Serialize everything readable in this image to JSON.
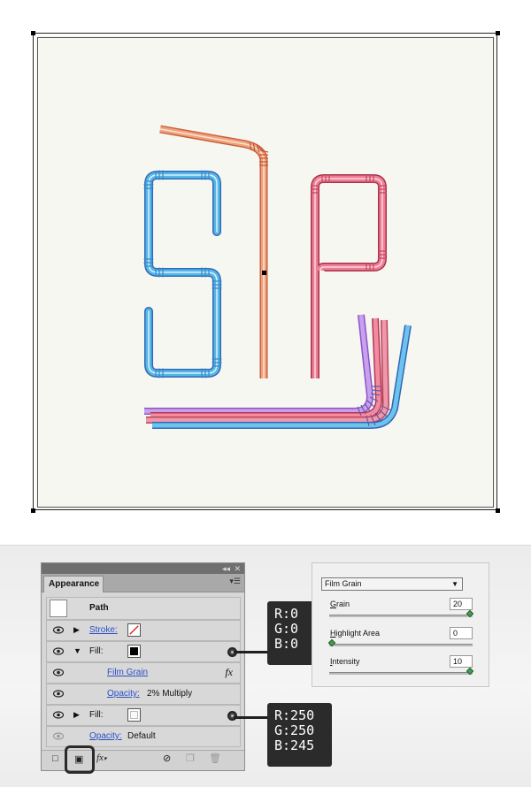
{
  "appearance_panel": {
    "tab_label": "Appearance",
    "rows": {
      "path_label": "Path",
      "stroke_label": "Stroke:",
      "fill1_label": "Fill:",
      "effect_label": "Film Grain",
      "opacity1_label": "Opacity:",
      "opacity1_value": "2% Multiply",
      "fill2_label": "Fill:",
      "opacity2_label": "Opacity:",
      "opacity2_value": "Default"
    },
    "fill1_color": "#000000",
    "fill2_color": "#FAFAF5"
  },
  "callouts": {
    "black": {
      "r": "R:0",
      "g": "G:0",
      "b": "B:0"
    },
    "cream": {
      "r": "R:250",
      "g": "G:250",
      "b": "B:245"
    }
  },
  "film_grain_dialog": {
    "selected_effect": "Film Grain",
    "grain_label_first": "G",
    "grain_label_rest": "rain",
    "grain_value": "20",
    "grain_fraction": 1.0,
    "highlight_label_first": "H",
    "highlight_label_rest": "ighlight Area",
    "highlight_value": "0",
    "highlight_fraction": 0.0,
    "intensity_label_first": "I",
    "intensity_label_rest": "ntensity",
    "intensity_value": "10",
    "intensity_fraction": 1.0
  },
  "colors": {
    "artboard_bg": "#F7F7F2",
    "straw_blue": "#56B8E6",
    "straw_dark_blue": "#2E67B8",
    "straw_orange": "#E8916A",
    "straw_pink": "#E06B83",
    "straw_purple": "#B88BE0"
  },
  "icons": [
    "eye-icon",
    "expand-triangle-icon",
    "collapse-triangle-icon",
    "fx-icon",
    "circle-connector-icon",
    "new-art-basic-icon",
    "clear-appearance-icon",
    "duplicate-icon",
    "trash-icon",
    "panel-menu-icon",
    "dropdown-arrow-icon"
  ]
}
